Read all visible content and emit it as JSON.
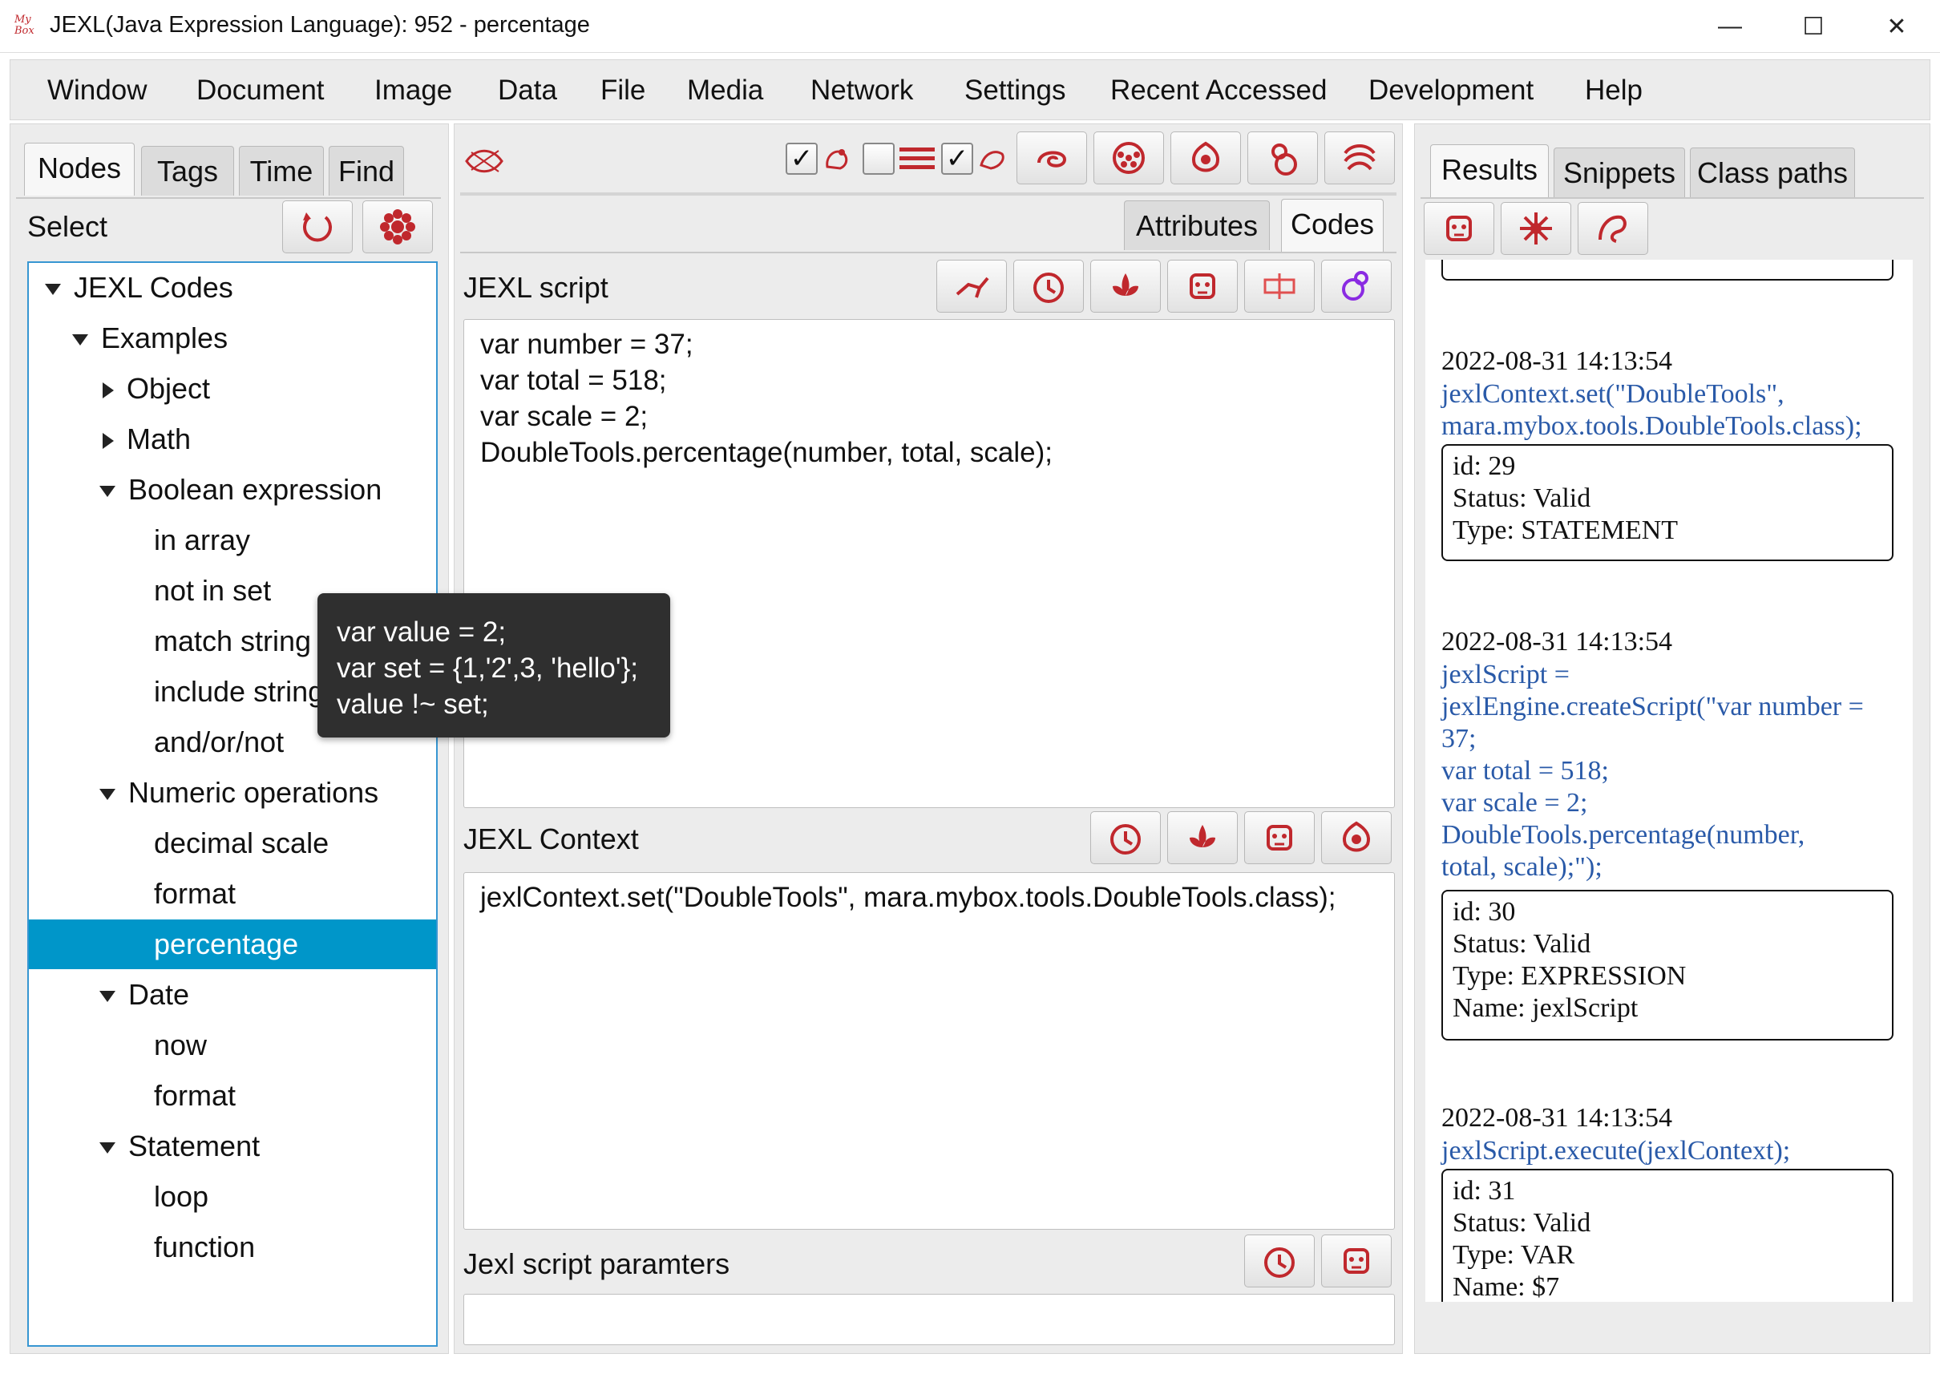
{
  "window": {
    "title": "JEXL(Java Expression Language): 952 - percentage",
    "logo_text": "My Box",
    "controls": {
      "minimize": "—",
      "maximize": "☐",
      "close": "✕"
    }
  },
  "menu": [
    "Window",
    "Document",
    "Image",
    "Data",
    "File",
    "Media",
    "Network",
    "Settings",
    "Recent Accessed",
    "Development",
    "Help"
  ],
  "left": {
    "tabs": [
      "Nodes",
      "Tags",
      "Time",
      "Find"
    ],
    "active_tab": "Nodes",
    "select_label": "Select",
    "tree": [
      {
        "label": "JEXL Codes",
        "level": 0,
        "arrow": "down"
      },
      {
        "label": "Examples",
        "level": 1,
        "arrow": "down"
      },
      {
        "label": "Object",
        "level": 2,
        "arrow": "right"
      },
      {
        "label": "Math",
        "level": 2,
        "arrow": "right"
      },
      {
        "label": "Boolean expression",
        "level": 2,
        "arrow": "down"
      },
      {
        "label": "in array",
        "level": 3,
        "arrow": ""
      },
      {
        "label": "not in set",
        "level": 3,
        "arrow": ""
      },
      {
        "label": "match string",
        "level": 3,
        "arrow": ""
      },
      {
        "label": "include string",
        "level": 3,
        "arrow": ""
      },
      {
        "label": "and/or/not",
        "level": 3,
        "arrow": ""
      },
      {
        "label": "Numeric operations",
        "level": 2,
        "arrow": "down"
      },
      {
        "label": "decimal scale",
        "level": 3,
        "arrow": ""
      },
      {
        "label": "format",
        "level": 3,
        "arrow": ""
      },
      {
        "label": "percentage",
        "level": 3,
        "arrow": "",
        "selected": true
      },
      {
        "label": "Date",
        "level": 2,
        "arrow": "down"
      },
      {
        "label": "now",
        "level": 3,
        "arrow": ""
      },
      {
        "label": "format",
        "level": 3,
        "arrow": ""
      },
      {
        "label": "Statement",
        "level": 2,
        "arrow": "down"
      },
      {
        "label": "loop",
        "level": 3,
        "arrow": ""
      },
      {
        "label": "function",
        "level": 3,
        "arrow": ""
      }
    ]
  },
  "tooltip": {
    "text": "var value = 2;\nvar set = {1,'2',3, 'hello'};\nvalue !~ set;"
  },
  "center": {
    "tabs": [
      "Attributes",
      "Codes"
    ],
    "active_tab": "Codes",
    "script_label": "JEXL script",
    "script": "var number = 37;\nvar total = 518;\nvar scale = 2;\nDoubleTools.percentage(number, total, scale);",
    "context_label": "JEXL Context",
    "context": "jexlContext.set(\"DoubleTools\", mara.mybox.tools.DoubleTools.class);",
    "params_label": "Jexl script paramters",
    "params": ""
  },
  "right": {
    "tabs": [
      "Results",
      "Snippets",
      "Class paths"
    ],
    "active_tab": "Results",
    "results": [
      {
        "time": "2022-08-31 14:13:54",
        "code": "jexlContext.set(\"DoubleTools\",\nmara.mybox.tools.DoubleTools.class);",
        "info": "id: 29\nStatus: Valid\nType: STATEMENT"
      },
      {
        "time": "2022-08-31 14:13:54",
        "code": "jexlScript =\njexlEngine.createScript(\"var number =\n37;\nvar total = 518;\nvar scale = 2;\nDoubleTools.percentage(number,\ntotal, scale);\");",
        "info": "id: 30\nStatus: Valid\nType: EXPRESSION\nName: jexlScript"
      },
      {
        "time": "2022-08-31 14:13:54",
        "code": "jexlScript.execute(jexlContext);",
        "info": "id: 31\nStatus: Valid\nType: VAR\nName: $7"
      }
    ]
  },
  "colors": {
    "accent_red": "#c0282d",
    "selection": "#0096c9",
    "tree_border": "#3796d2",
    "code_blue": "#2a5aa8"
  }
}
